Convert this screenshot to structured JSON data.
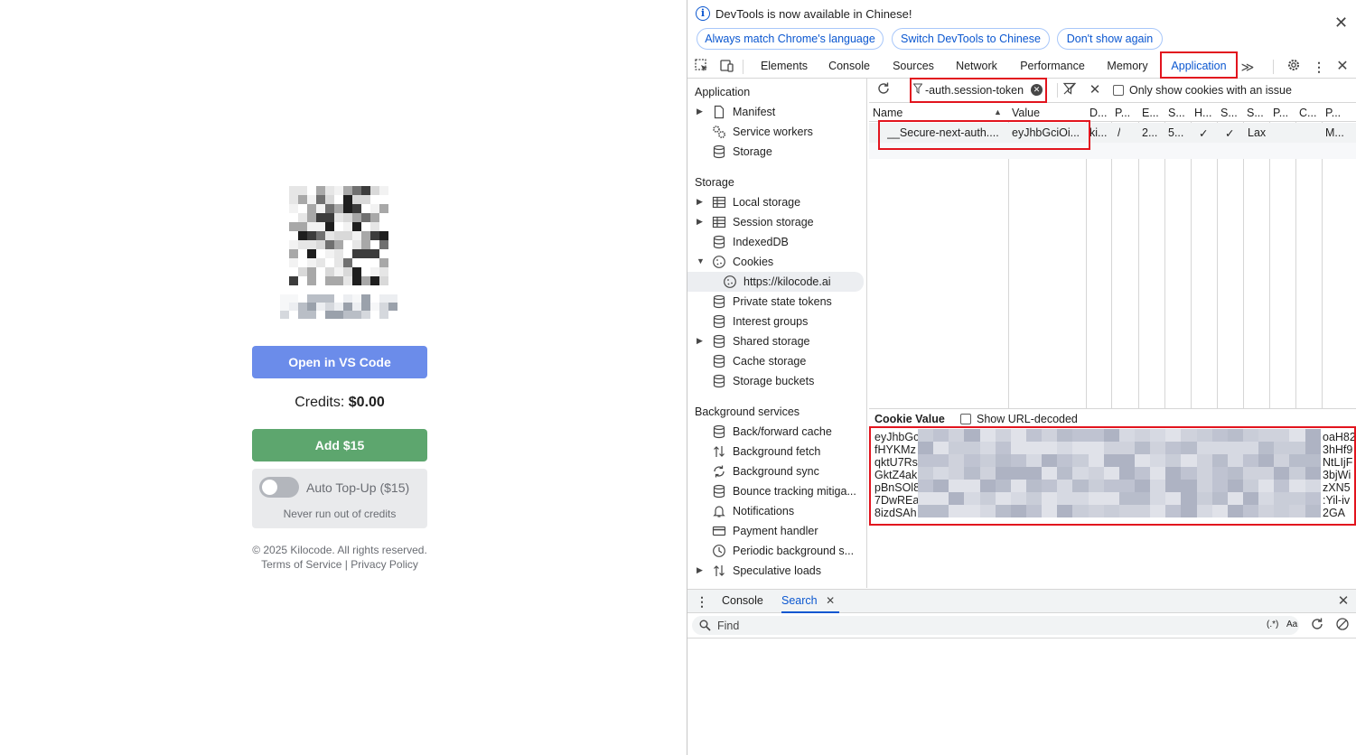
{
  "page": {
    "open_vscode_label": "Open in VS Code",
    "credits_label": "Credits:",
    "credits_value": "$0.00",
    "add_label": "Add $15",
    "auto_topup_label": "Auto Top-Up ($15)",
    "auto_topup_enabled": false,
    "auto_topup_sub": "Never run out of credits",
    "copyright": "© 2025 Kilocode. All rights reserved.",
    "terms_label": "Terms of Service",
    "separator": "|",
    "privacy_label": "Privacy Policy"
  },
  "banner": {
    "message": "DevTools is now available in Chinese!",
    "buttons": [
      "Always match Chrome's language",
      "Switch DevTools to Chinese",
      "Don't show again"
    ],
    "close_icon": "close-icon"
  },
  "tabs": [
    "Elements",
    "Console",
    "Sources",
    "Network",
    "Performance",
    "Memory",
    "Application"
  ],
  "active_tab": "Application",
  "overflow_glyph": "≫",
  "sidebar": {
    "application_heading": "Application",
    "application_items": [
      "Manifest",
      "Service workers",
      "Storage"
    ],
    "storage_heading": "Storage",
    "storage_items": [
      "Local storage",
      "Session storage",
      "IndexedDB",
      "Cookies",
      "https://kilocode.ai",
      "Private state tokens",
      "Interest groups",
      "Shared storage",
      "Cache storage",
      "Storage buckets"
    ],
    "background_heading": "Background services",
    "background_items": [
      "Back/forward cache",
      "Background fetch",
      "Background sync",
      "Bounce tracking mitiga...",
      "Notifications",
      "Payment handler",
      "Periodic background s...",
      "Speculative loads"
    ]
  },
  "cookies": {
    "filter_value": "-auth.session-token",
    "only_issue_label": "Only show cookies with an issue",
    "columns": [
      "Name",
      "Value",
      "D...",
      "P...",
      "E...",
      "S...",
      "H...",
      "S...",
      "S...",
      "P...",
      "C...",
      "P..."
    ],
    "row": [
      "__Secure-next-auth....",
      "eyJhbGciOi...",
      "ki...",
      "/",
      "2...",
      "5...",
      "✓",
      "✓",
      "Lax",
      "",
      "",
      "M..."
    ],
    "cookie_value_title": "Cookie Value",
    "show_decoded_label": "Show URL-decoded",
    "value_line_starts": [
      "eyJhbGc",
      "fHYKMz",
      "qktU7Rs",
      "GktZ4ak",
      "pBnSOl8",
      "7DwREa",
      "8izdSAh"
    ],
    "value_line_ends": [
      "oaH82",
      "3hHf9",
      "NtLIjF",
      "3bjWi",
      "zXN5",
      ":Yil-iv",
      "2GA"
    ]
  },
  "drawer": {
    "tabs": [
      "Console",
      "Search"
    ],
    "active": "Search",
    "find_placeholder": "Find",
    "regex_label": "(.*)",
    "case_label": "Aa"
  },
  "colors": {
    "accent": "#0b57d0",
    "highlight": "#e2141e",
    "vscode_button": "#6b8cea",
    "add_button": "#5da66e"
  }
}
